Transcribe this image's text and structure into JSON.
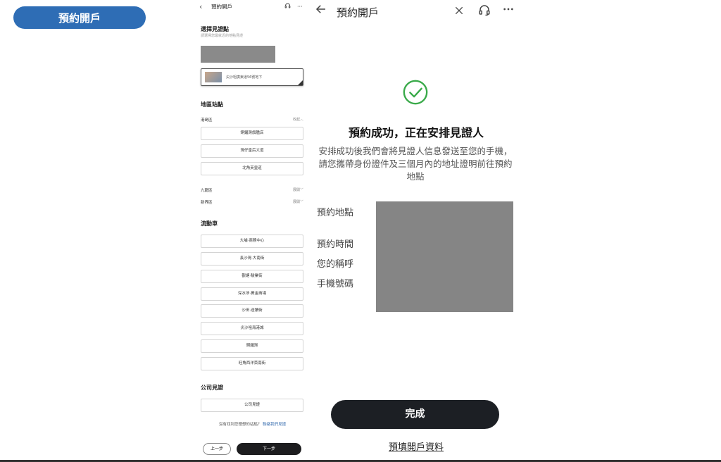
{
  "banner": {
    "label": "預約開戶"
  },
  "left_screen": {
    "header": {
      "title": "預約開戶",
      "back_glyph": "‹",
      "more_glyph": "···"
    },
    "select": {
      "title": "選擇見證點",
      "subtitle": "請選擇您最就近的地點見證"
    },
    "promo_card": {
      "text": "尖沙咀廣東道56號地下"
    },
    "district_section": {
      "title": "地區站點"
    },
    "hk_island": {
      "label": "港島區",
      "toggle": "收起︿",
      "branches": [
        "銅鑼灣旗艦店",
        "灣仔皇后大道",
        "北角英皇道"
      ]
    },
    "kowloon": {
      "label": "九龍區",
      "toggle": "展開﹀"
    },
    "nt": {
      "label": "新界區",
      "toggle": "展開﹀"
    },
    "mobile_section": {
      "title": "流動車",
      "stops": [
        "大埔·商務中心",
        "長沙灣·大南街",
        "觀塘·駿業街",
        "深水埗·黃金商場",
        "沙田·送讀街",
        "尖沙咀海港城",
        "銅鑼灣",
        "旺角西洋菜南街"
      ]
    },
    "company_section": {
      "title": "公司見證",
      "button": "公司見證"
    },
    "help": {
      "text": "沒有找到您理想的站點？",
      "link": "聯絡我們見證"
    },
    "prev": "上一步",
    "next": "下一步"
  },
  "right_screen": {
    "header": {
      "title": "預約開戶"
    },
    "heading": "預約成功，正在安排見證人",
    "description": "安排成功後我們會將見證人信息發送至您的手機，請您攜帶身份證件及三個月內的地址證明前往預約地點",
    "labels": {
      "location": "預約地點",
      "time": "預約時間",
      "name": "您的稱呼",
      "phone": "手機號碼"
    },
    "done_button": "完成",
    "prefill_link": "預填開戶資料"
  },
  "colors": {
    "banner": "#2e6db5",
    "primary_button": "#1c1f24",
    "success": "#3aaa4a",
    "redaction": "#858585"
  }
}
